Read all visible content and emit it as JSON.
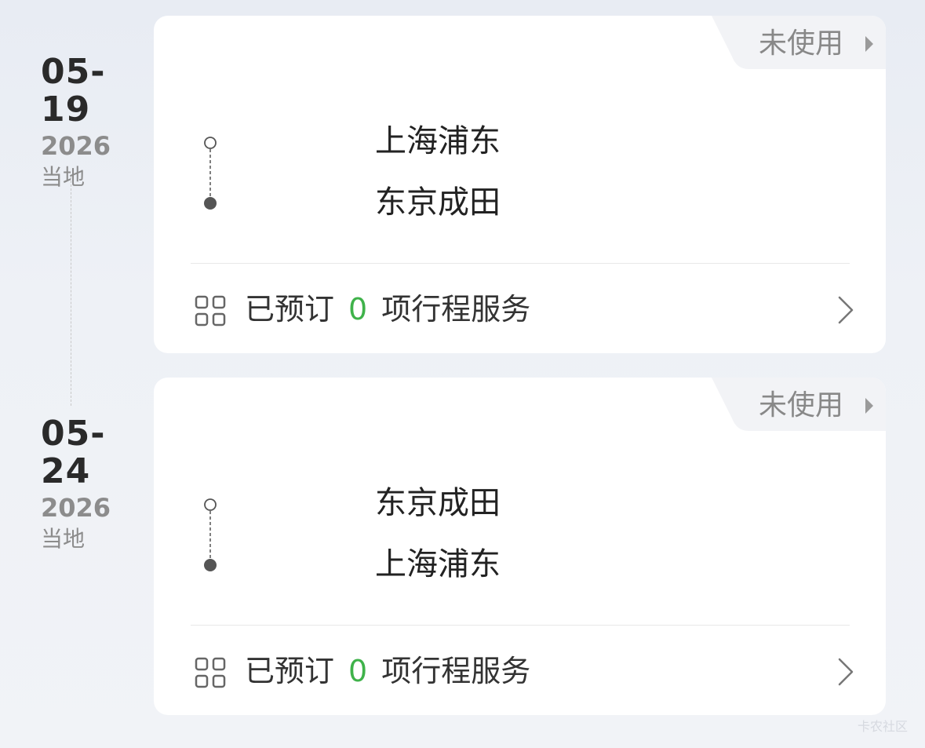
{
  "trips": [
    {
      "date": "05-19",
      "year": "2026",
      "timezone": "当地",
      "status": "未使用",
      "from": "上海浦东",
      "to": "东京成田",
      "services_prefix": "已预订",
      "services_count": "0",
      "services_suffix": "项行程服务"
    },
    {
      "date": "05-24",
      "year": "2026",
      "timezone": "当地",
      "status": "未使用",
      "from": "东京成田",
      "to": "上海浦东",
      "services_prefix": "已预订",
      "services_count": "0",
      "services_suffix": "项行程服务"
    }
  ],
  "watermark": "卡农社区",
  "colors": {
    "accent_count": "#3fb24a",
    "muted_text": "#8c8c8c",
    "card_bg": "#ffffff"
  }
}
